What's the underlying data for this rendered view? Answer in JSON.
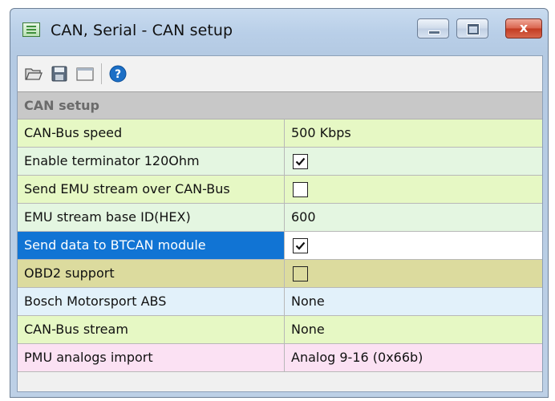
{
  "window": {
    "title": "CAN, Serial - CAN setup",
    "close_glyph": "x"
  },
  "toolbar": {
    "buttons": [
      {
        "name": "open",
        "icon": "folder-open-icon"
      },
      {
        "name": "save",
        "icon": "floppy-disk-icon"
      },
      {
        "name": "blank",
        "icon": "window-icon"
      },
      {
        "name": "help",
        "icon": "help-icon",
        "glyph": "?"
      }
    ]
  },
  "colors": {
    "yellow": "#e6f8c4",
    "mint": "#e4f6e1",
    "olive": "#dcdb9e",
    "blue": "#e2f1fa",
    "pink": "#fbe1f3",
    "selection": "#1174d4"
  },
  "grid": {
    "section_title": "CAN setup",
    "rows": [
      {
        "label": "CAN-Bus speed",
        "value": "500 Kbps"
      },
      {
        "label": "Enable terminator 120Ohm",
        "checked": true
      },
      {
        "label": "Send EMU stream over CAN-Bus",
        "checked": false
      },
      {
        "label": "EMU stream base ID(HEX)",
        "value": "600"
      },
      {
        "label": "Send data to BTCAN module",
        "checked": true,
        "selected": true
      },
      {
        "label": "OBD2 support",
        "checked": false
      },
      {
        "label": "Bosch Motorsport ABS",
        "value": "None"
      },
      {
        "label": "CAN-Bus stream",
        "value": "None"
      },
      {
        "label": "PMU analogs import",
        "value": "Analog 9-16 (0x66b)"
      }
    ]
  }
}
